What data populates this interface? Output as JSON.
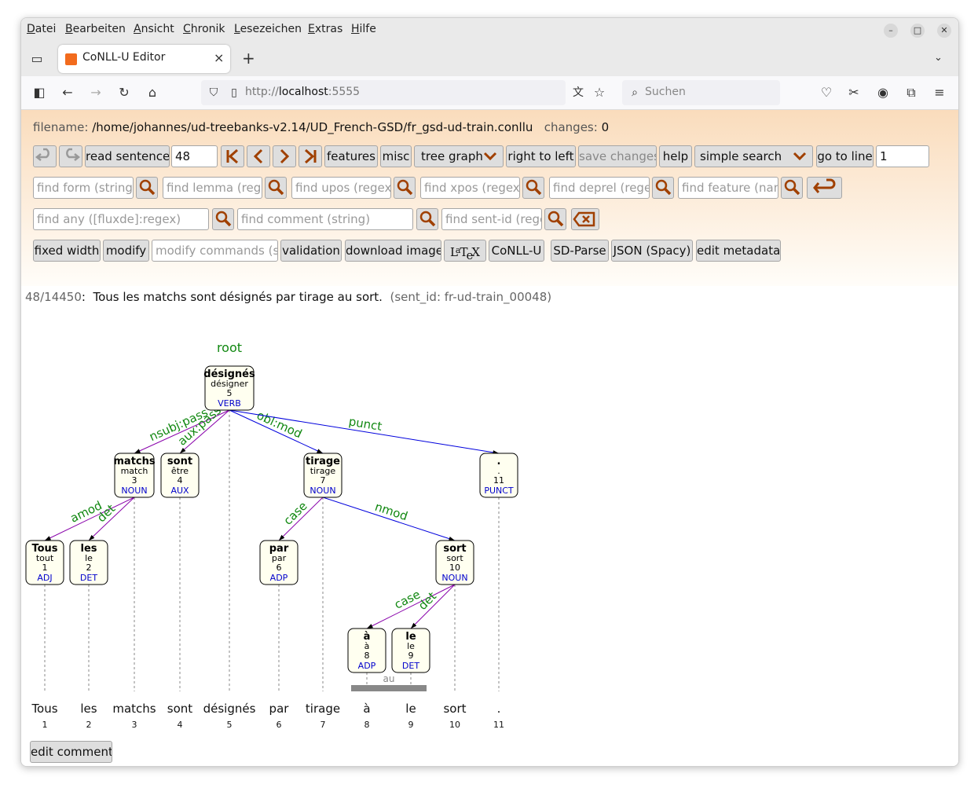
{
  "menu": {
    "items": [
      {
        "key": "D",
        "rest": "atei"
      },
      {
        "key": "B",
        "rest": "earbeiten"
      },
      {
        "key": "A",
        "rest": "nsicht"
      },
      {
        "key": "C",
        "rest": "hronik"
      },
      {
        "key": "L",
        "rest": "esezeichen"
      },
      {
        "key": "E",
        "rest": "xtras"
      },
      {
        "key": "H",
        "rest": "ilfe"
      }
    ]
  },
  "browser": {
    "tab_title": "CoNLL-U Editor",
    "tab_close": "×",
    "new_tab": "+",
    "url_prefix": "http://",
    "url_host": "localhost",
    "url_port": ":5555",
    "search_placeholder": "Suchen"
  },
  "fileinfo": {
    "filename_label": "filename:",
    "filename": "/home/johannes/ud-treebanks-v2.14/UD_French-GSD/fr_gsd-ud-train.conllu",
    "changes_label": "changes:",
    "changes": "0"
  },
  "toolbar": {
    "read_sentence": "read sentence",
    "sentence_number": "48",
    "features": "features",
    "misc": "misc",
    "view_mode": "tree graph",
    "right_to_left": "right to left",
    "save_changes": "save changes",
    "help": "help",
    "search_mode": "simple search",
    "go_to_line": "go to line",
    "line_number": "1"
  },
  "finders": {
    "form": "find form (string)",
    "lemma": "find lemma (regex)",
    "upos": "find upos (regex/...)",
    "xpos": "find xpos (regex/...)",
    "deprel": "find deprel (regex)",
    "feature": "find feature (name)",
    "any": "find any ([fluxde]:regex)",
    "comment": "find comment (string)",
    "sentid": "find sent-id (regex)"
  },
  "actions": {
    "fixed_width": "fixed width",
    "modify": "modify",
    "modify_placeholder": "modify commands (see help)",
    "validation": "validation",
    "download_image": "download image",
    "latex": "LaTeX",
    "conllu": "CoNLL-U",
    "sdparse": "SD-Parse",
    "json": "JSON (Spacy)",
    "edit_metadata": "edit metadata",
    "edit_comment": "edit comment"
  },
  "sentence": {
    "index": "48",
    "total": "/14450",
    "separator": ":",
    "text": "Tous les matchs sont désignés par tirage au sort.",
    "sent_id": "(sent_id: fr-ud-train_00048)"
  },
  "colors": {
    "deprel": "#118811",
    "upos": "#0000cc",
    "left_arc": "#8800aa",
    "right_arc": "#0000dd",
    "node_fill": "#fffff0",
    "button_icon": "#a04000"
  },
  "tree": {
    "root_label": "root",
    "tokens": [
      {
        "id": "1",
        "form": "Tous",
        "lemma": "tout",
        "upos": "ADJ"
      },
      {
        "id": "2",
        "form": "les",
        "lemma": "le",
        "upos": "DET"
      },
      {
        "id": "3",
        "form": "matchs",
        "lemma": "match",
        "upos": "NOUN"
      },
      {
        "id": "4",
        "form": "sont",
        "lemma": "être",
        "upos": "AUX"
      },
      {
        "id": "5",
        "form": "désignés",
        "lemma": "désigner",
        "upos": "VERB"
      },
      {
        "id": "6",
        "form": "par",
        "lemma": "par",
        "upos": "ADP"
      },
      {
        "id": "7",
        "form": "tirage",
        "lemma": "tirage",
        "upos": "NOUN"
      },
      {
        "id": "8",
        "form": "à",
        "lemma": "à",
        "upos": "ADP"
      },
      {
        "id": "9",
        "form": "le",
        "lemma": "le",
        "upos": "DET"
      },
      {
        "id": "10",
        "form": "sort",
        "lemma": "sort",
        "upos": "NOUN"
      },
      {
        "id": "11",
        "form": ".",
        "lemma": ".",
        "upos": "PUNCT"
      }
    ],
    "relations": [
      {
        "dep": "1",
        "head": "3",
        "label": "amod"
      },
      {
        "dep": "2",
        "head": "3",
        "label": "det"
      },
      {
        "dep": "3",
        "head": "5",
        "label": "nsubj:pass"
      },
      {
        "dep": "4",
        "head": "5",
        "label": "aux:pass"
      },
      {
        "dep": "5",
        "head": "0",
        "label": "root"
      },
      {
        "dep": "6",
        "head": "7",
        "label": "case"
      },
      {
        "dep": "7",
        "head": "5",
        "label": "obl:mod"
      },
      {
        "dep": "8",
        "head": "10",
        "label": "case"
      },
      {
        "dep": "9",
        "head": "10",
        "label": "det"
      },
      {
        "dep": "10",
        "head": "7",
        "label": "nmod"
      },
      {
        "dep": "11",
        "head": "5",
        "label": "punct"
      }
    ],
    "mwt": {
      "form": "au",
      "from": "8",
      "to": "9"
    }
  }
}
